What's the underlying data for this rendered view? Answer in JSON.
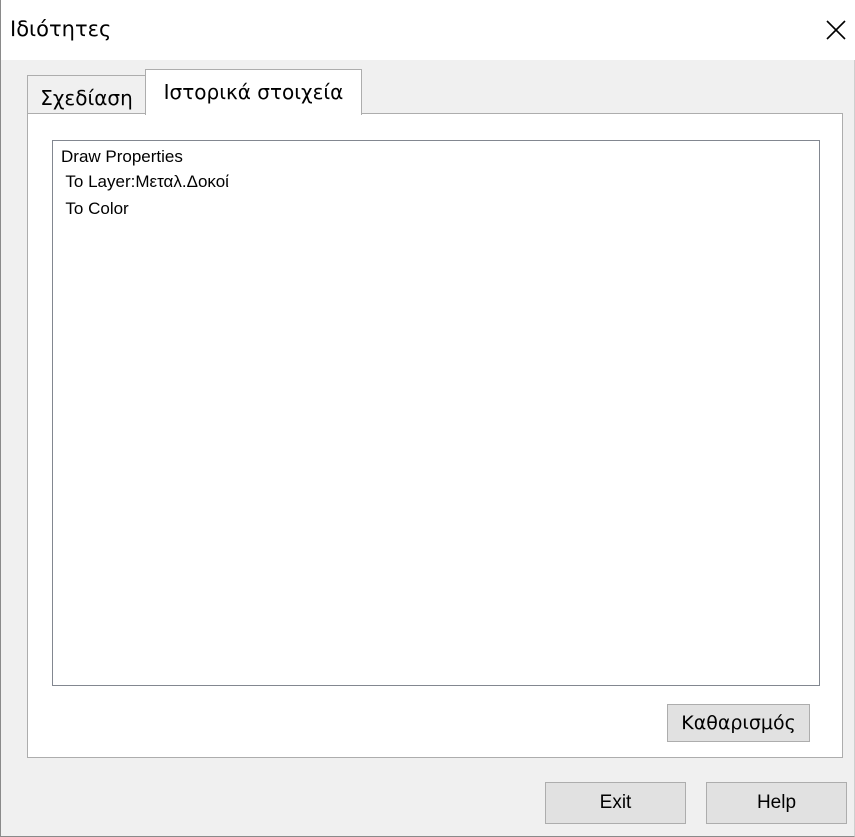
{
  "window": {
    "title": "Ιδιότητες",
    "close_label": "Close"
  },
  "tabs": [
    {
      "label": "Σχεδίαση",
      "active": false
    },
    {
      "label": "Ιστορικά στοιχεία",
      "active": true
    }
  ],
  "history": {
    "lines": [
      "Draw Properties",
      " To Layer:Μεταλ.Δοκοί",
      " To Color"
    ]
  },
  "buttons": {
    "clear_label": "Καθαρισμός",
    "exit_label": "Exit",
    "help_label": "Help"
  },
  "colors": {
    "dialog_bg": "#f0f0f0",
    "button_bg": "#e1e1e1",
    "border": "#adadad"
  },
  "icons": {
    "close": "close-icon"
  }
}
